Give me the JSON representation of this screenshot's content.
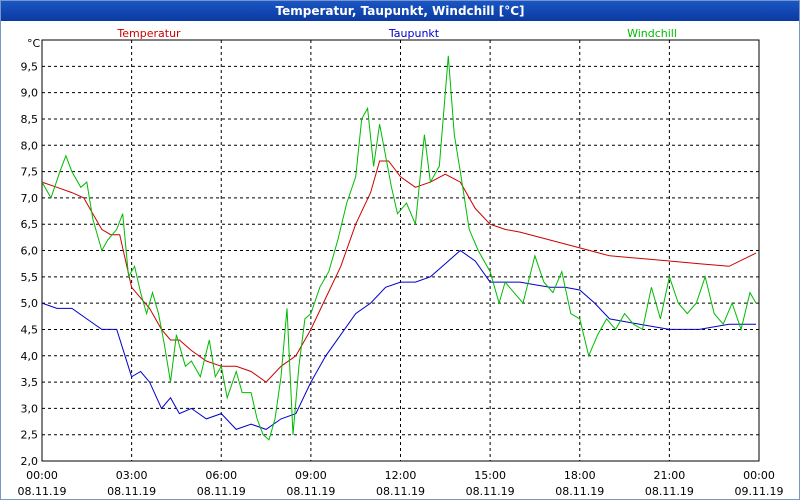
{
  "window": {
    "title": "Temperatur, Taupunkt, Windchill [°C]"
  },
  "chart_data": {
    "type": "line",
    "title": "Temperatur, Taupunkt, Windchill [°C]",
    "ylabel": "°C",
    "xlabel": "",
    "ylim": [
      2.0,
      10.0
    ],
    "xlim": [
      0,
      24
    ],
    "grid": true,
    "legend": "top",
    "y_ticks": [
      "2,0",
      "2,5",
      "3,0",
      "3,5",
      "4,0",
      "4,5",
      "5,0",
      "5,5",
      "6,0",
      "6,5",
      "7,0",
      "7,5",
      "8,0",
      "8,5",
      "9,0",
      "9,5"
    ],
    "x_ticks": [
      {
        "time": "00:00",
        "date": "08.11.19"
      },
      {
        "time": "03:00",
        "date": "08.11.19"
      },
      {
        "time": "06:00",
        "date": "08.11.19"
      },
      {
        "time": "09:00",
        "date": "08.11.19"
      },
      {
        "time": "12:00",
        "date": "08.11.19"
      },
      {
        "time": "15:00",
        "date": "08.11.19"
      },
      {
        "time": "18:00",
        "date": "08.11.19"
      },
      {
        "time": "21:00",
        "date": "08.11.19"
      },
      {
        "time": "00:00",
        "date": "09.11.19"
      }
    ],
    "series": [
      {
        "name": "Temperatur",
        "color": "#cc0000",
        "x": [
          0,
          0.5,
          1,
          1.4,
          1.7,
          2,
          2.3,
          2.6,
          3,
          3.3,
          3.6,
          4,
          4.3,
          4.6,
          5,
          5.5,
          6,
          6.5,
          7,
          7.5,
          8,
          8.5,
          9,
          9.5,
          10,
          10.5,
          11,
          11.3,
          11.6,
          12,
          12.5,
          13,
          13.5,
          14,
          14.5,
          15,
          15.5,
          16,
          17,
          18,
          19,
          20,
          21,
          22,
          23,
          23.9
        ],
        "values": [
          7.3,
          7.2,
          7.1,
          7.0,
          6.7,
          6.4,
          6.3,
          6.3,
          5.3,
          5.1,
          4.9,
          4.5,
          4.3,
          4.3,
          4.1,
          3.9,
          3.8,
          3.8,
          3.7,
          3.5,
          3.8,
          4.0,
          4.5,
          5.1,
          5.7,
          6.5,
          7.1,
          7.7,
          7.7,
          7.4,
          7.2,
          7.3,
          7.45,
          7.3,
          6.8,
          6.5,
          6.4,
          6.35,
          6.2,
          6.05,
          5.9,
          5.85,
          5.8,
          5.75,
          5.7,
          5.95
        ]
      },
      {
        "name": "Taupunkt",
        "color": "#0000cc",
        "x": [
          0,
          0.5,
          1,
          1.5,
          2,
          2.5,
          3,
          3.3,
          3.6,
          4,
          4.3,
          4.6,
          5,
          5.5,
          6,
          6.5,
          7,
          7.5,
          8,
          8.5,
          9,
          9.5,
          10,
          10.5,
          11,
          11.5,
          12,
          12.5,
          13,
          13.5,
          14,
          14.5,
          15,
          16,
          16.5,
          17,
          17.5,
          18,
          18.5,
          19,
          20,
          21,
          22,
          23,
          23.9
        ],
        "values": [
          5.0,
          4.9,
          4.9,
          4.7,
          4.5,
          4.5,
          3.6,
          3.7,
          3.5,
          3.0,
          3.2,
          2.9,
          3.0,
          2.8,
          2.9,
          2.6,
          2.7,
          2.6,
          2.8,
          2.9,
          3.5,
          4.0,
          4.4,
          4.8,
          5.0,
          5.3,
          5.4,
          5.4,
          5.5,
          5.75,
          6.0,
          5.8,
          5.4,
          5.4,
          5.35,
          5.3,
          5.3,
          5.25,
          5.0,
          4.7,
          4.6,
          4.5,
          4.5,
          4.6,
          4.6
        ]
      },
      {
        "name": "Windchill",
        "color": "#00bb00",
        "x": [
          0,
          0.3,
          0.6,
          0.8,
          1.0,
          1.3,
          1.5,
          1.7,
          2.0,
          2.2,
          2.5,
          2.7,
          2.9,
          3.1,
          3.3,
          3.5,
          3.7,
          3.9,
          4.1,
          4.3,
          4.5,
          4.8,
          5.0,
          5.3,
          5.6,
          5.8,
          6.0,
          6.2,
          6.5,
          6.7,
          7.0,
          7.2,
          7.4,
          7.6,
          7.8,
          8.0,
          8.2,
          8.4,
          8.6,
          8.8,
          9.0,
          9.3,
          9.6,
          9.9,
          10.2,
          10.5,
          10.7,
          10.9,
          11.1,
          11.3,
          11.5,
          11.7,
          11.9,
          12.2,
          12.5,
          12.8,
          13.0,
          13.3,
          13.6,
          13.8,
          14.0,
          14.3,
          14.6,
          15.0,
          15.3,
          15.5,
          15.8,
          16.1,
          16.5,
          16.8,
          17.1,
          17.4,
          17.7,
          18.0,
          18.3,
          18.6,
          18.9,
          19.2,
          19.5,
          19.8,
          20.1,
          20.4,
          20.7,
          21.0,
          21.3,
          21.6,
          21.9,
          22.2,
          22.5,
          22.8,
          23.1,
          23.4,
          23.7,
          23.9
        ],
        "values": [
          7.3,
          7.0,
          7.5,
          7.8,
          7.5,
          7.2,
          7.3,
          6.6,
          6.0,
          6.2,
          6.4,
          6.7,
          5.5,
          5.7,
          5.2,
          4.8,
          5.2,
          4.8,
          4.2,
          3.5,
          4.4,
          3.8,
          3.9,
          3.6,
          4.3,
          3.6,
          3.8,
          3.2,
          3.7,
          3.3,
          3.3,
          2.8,
          2.5,
          2.4,
          2.8,
          3.6,
          4.9,
          2.5,
          3.8,
          4.7,
          4.8,
          5.3,
          5.6,
          6.2,
          6.9,
          7.4,
          8.5,
          8.7,
          7.6,
          8.4,
          7.8,
          7.2,
          6.7,
          6.9,
          6.5,
          8.2,
          7.3,
          7.6,
          9.7,
          8.2,
          7.5,
          6.4,
          6.0,
          5.6,
          5.0,
          5.4,
          5.2,
          5.0,
          5.9,
          5.4,
          5.2,
          5.6,
          4.8,
          4.7,
          4.0,
          4.4,
          4.7,
          4.5,
          4.8,
          4.6,
          4.5,
          5.3,
          4.7,
          5.5,
          5.0,
          4.8,
          5.0,
          5.5,
          4.8,
          4.6,
          5.0,
          4.5,
          5.2,
          5.0
        ]
      }
    ]
  }
}
